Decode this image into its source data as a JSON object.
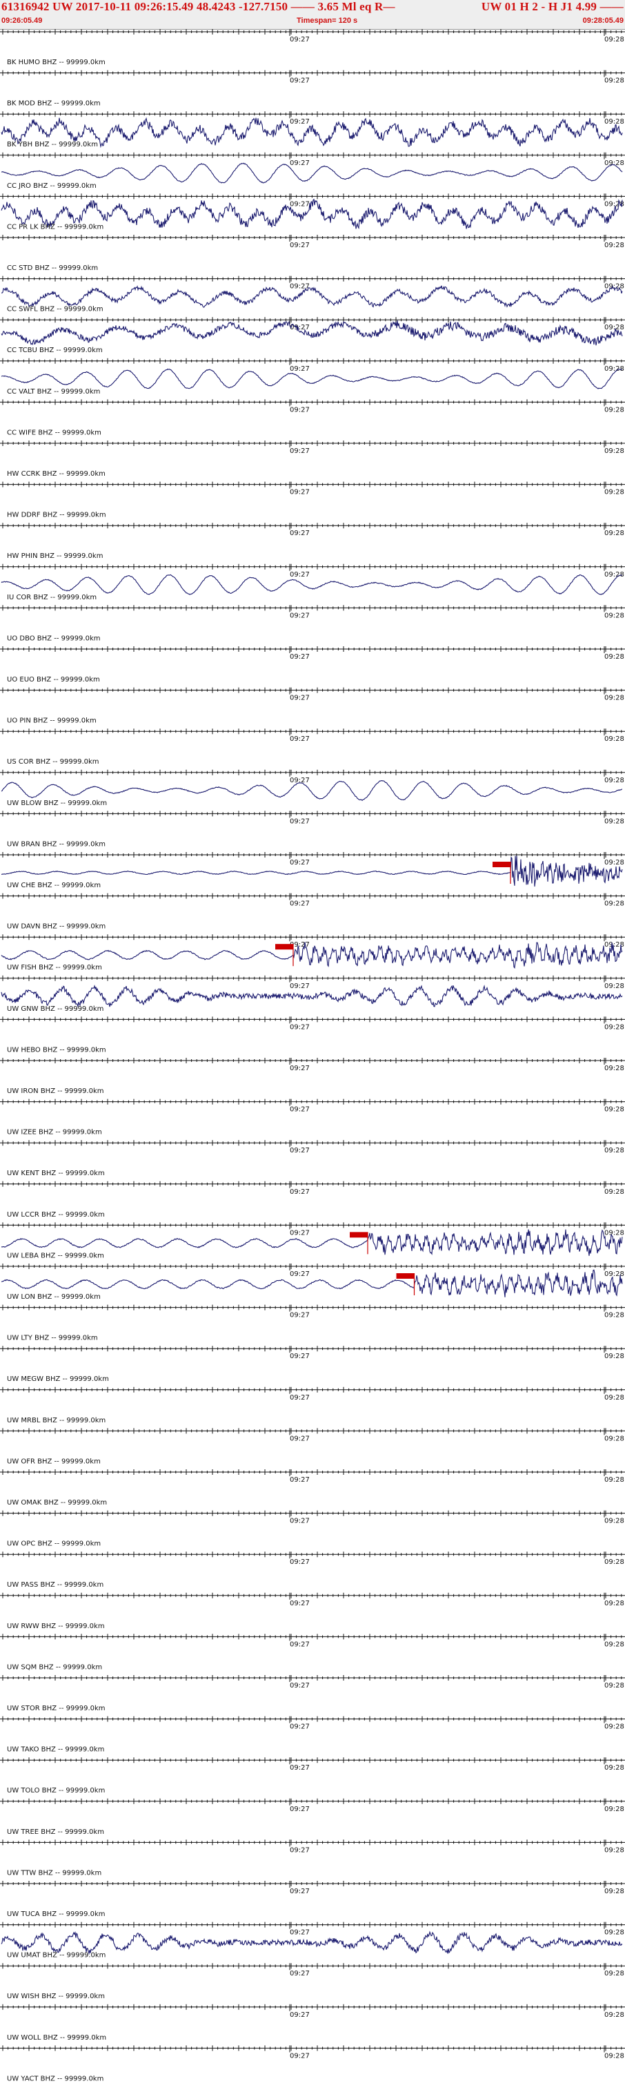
{
  "header": {
    "line1_left": "61316942 UW 2017-10-11 09:26:15.49   48.4243 -127.7150 —— 3.65 Ml  eq   R—",
    "line1_right": "UW 01   H   2  -  H J1     4.99 ——",
    "start_time": "09:26:05.49",
    "timespan": "Timespan= 120 s",
    "end_time": "09:28:05.49"
  },
  "time_labels": {
    "mid": "09:27",
    "end": "09:28"
  },
  "colors": {
    "trace": "#1a1a6e",
    "axis": "#111111",
    "pick": "#cc0000",
    "header_text": "#d01010"
  },
  "channels": [
    {
      "label": "BK HUMO BHZ -- 99999.0km",
      "trace": "none"
    },
    {
      "label": "BK MOD BHZ -- 99999.0km",
      "trace": "none"
    },
    {
      "label": "BK YBH BHZ -- 99999.0km",
      "trace": "noisy_strong"
    },
    {
      "label": "CC JRO BHZ -- 99999.0km",
      "trace": "smooth_wave"
    },
    {
      "label": "CC PR LK BHZ -- 99999.0km",
      "trace": "noisy_strong"
    },
    {
      "label": "CC STD BHZ -- 99999.0km",
      "trace": "none"
    },
    {
      "label": "CC SWFL BHZ -- 99999.0km",
      "trace": "noisy_medium"
    },
    {
      "label": "CC TCBU BHZ -- 99999.0km",
      "trace": "noisy_drift"
    },
    {
      "label": "CC VALT BHZ -- 99999.0km",
      "trace": "smooth_wave"
    },
    {
      "label": "CC WIFE BHZ -- 99999.0km",
      "trace": "none"
    },
    {
      "label": "HW CCRK BHZ -- 99999.0km",
      "trace": "none"
    },
    {
      "label": "HW DDRF BHZ -- 99999.0km",
      "trace": "none"
    },
    {
      "label": "HW PHIN BHZ -- 99999.0km",
      "trace": "none"
    },
    {
      "label": "IU COR BHZ -- 99999.0km",
      "trace": "smooth_wave"
    },
    {
      "label": "UO DBO BHZ -- 99999.0km",
      "trace": "none"
    },
    {
      "label": "UO EUO BHZ -- 99999.0km",
      "trace": "none"
    },
    {
      "label": "UO PIN BHZ -- 99999.0km",
      "trace": "none"
    },
    {
      "label": "US COR BHZ -- 99999.0km",
      "trace": "none"
    },
    {
      "label": "UW BLOW BHZ -- 99999.0km",
      "trace": "smooth_wave"
    },
    {
      "label": "UW BRAN BHZ -- 99999.0km",
      "trace": "none"
    },
    {
      "label": "UW CHE BHZ -- 99999.0km",
      "trace": "event",
      "pick_fraction": 0.82
    },
    {
      "label": "UW DAVN BHZ -- 99999.0km",
      "trace": "none"
    },
    {
      "label": "UW FISH BHZ -- 99999.0km",
      "trace": "event_mid",
      "pick_fraction": 0.47
    },
    {
      "label": "UW GNW BHZ -- 99999.0km",
      "trace": "noisy_wave"
    },
    {
      "label": "UW HEBO BHZ -- 99999.0km",
      "trace": "none"
    },
    {
      "label": "UW IRON BHZ -- 99999.0km",
      "trace": "none"
    },
    {
      "label": "UW IZEE BHZ -- 99999.0km",
      "trace": "none"
    },
    {
      "label": "UW KENT BHZ -- 99999.0km",
      "trace": "none"
    },
    {
      "label": "UW LCCR BHZ -- 99999.0km",
      "trace": "none"
    },
    {
      "label": "UW LEBA BHZ -- 99999.0km",
      "trace": "event_mid",
      "pick_fraction": 0.59
    },
    {
      "label": "UW LON BHZ -- 99999.0km",
      "trace": "event_mid",
      "pick_fraction": 0.665
    },
    {
      "label": "UW LTY BHZ -- 99999.0km",
      "trace": "none"
    },
    {
      "label": "UW MEGW BHZ -- 99999.0km",
      "trace": "none"
    },
    {
      "label": "UW MRBL BHZ -- 99999.0km",
      "trace": "none"
    },
    {
      "label": "UW OFR BHZ -- 99999.0km",
      "trace": "none"
    },
    {
      "label": "UW OMAK BHZ -- 99999.0km",
      "trace": "none"
    },
    {
      "label": "UW OPC BHZ -- 99999.0km",
      "trace": "none"
    },
    {
      "label": "UW PASS BHZ -- 99999.0km",
      "trace": "none"
    },
    {
      "label": "UW RWW BHZ -- 99999.0km",
      "trace": "none"
    },
    {
      "label": "UW SQM BHZ -- 99999.0km",
      "trace": "none"
    },
    {
      "label": "UW STOR BHZ -- 99999.0km",
      "trace": "none"
    },
    {
      "label": "UW TAKO BHZ -- 99999.0km",
      "trace": "none"
    },
    {
      "label": "UW TOLO BHZ -- 99999.0km",
      "trace": "none"
    },
    {
      "label": "UW TREE BHZ -- 99999.0km",
      "trace": "none"
    },
    {
      "label": "UW TTW BHZ -- 99999.0km",
      "trace": "none"
    },
    {
      "label": "UW TUCA BHZ -- 99999.0km",
      "trace": "none"
    },
    {
      "label": "UW UMAT BHZ -- 99999.0km",
      "trace": "noisy_wave"
    },
    {
      "label": "UW WISH BHZ -- 99999.0km",
      "trace": "none"
    },
    {
      "label": "UW WOLL BHZ -- 99999.0km",
      "trace": "none"
    },
    {
      "label": "UW YACT BHZ -- 99999.0km",
      "trace": "none"
    }
  ]
}
